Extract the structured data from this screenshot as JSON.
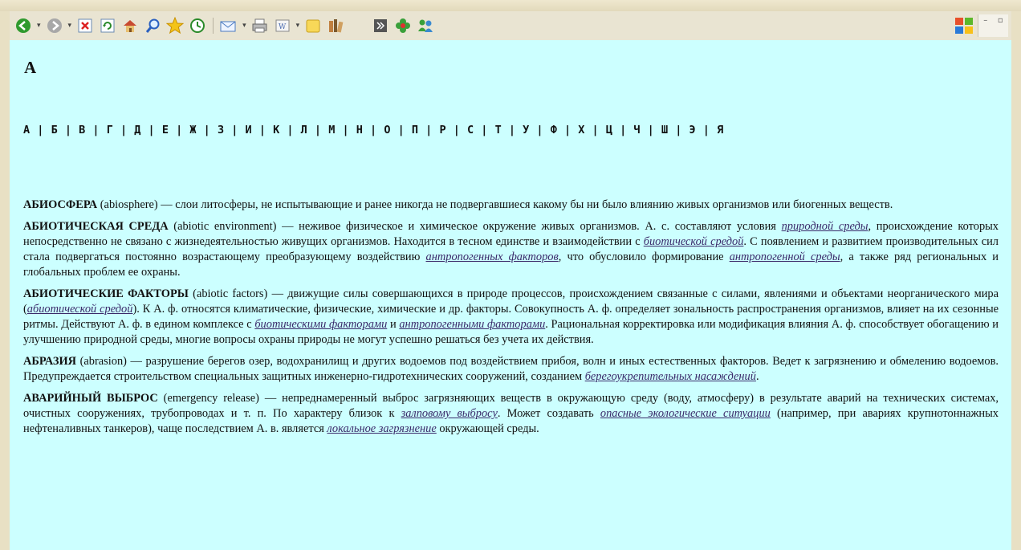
{
  "toolbar": {
    "buttons": [
      {
        "name": "back-button",
        "icon": "back-arrow-icon",
        "color": "#2a8a2a"
      },
      {
        "name": "forward-button",
        "icon": "forward-arrow-icon",
        "color": "#9a9a9a"
      },
      {
        "name": "stop-button",
        "icon": "stop-icon",
        "color": "#d22"
      },
      {
        "name": "refresh-button",
        "icon": "refresh-icon",
        "color": "#2a8a2a"
      },
      {
        "name": "home-button",
        "icon": "home-icon",
        "color": "#c8a040"
      },
      {
        "name": "search-button",
        "icon": "search-icon",
        "color": "#2a60c0"
      },
      {
        "name": "favorites-button",
        "icon": "star-icon",
        "color": "#f0c020"
      },
      {
        "name": "history-button",
        "icon": "history-icon",
        "color": "#2a8a2a"
      },
      {
        "name": "mail-button",
        "icon": "mail-icon",
        "color": "#4a7ac0"
      },
      {
        "name": "print-button",
        "icon": "print-icon",
        "color": "#777"
      },
      {
        "name": "edit-button",
        "icon": "word-icon",
        "color": "#4a6ab0"
      },
      {
        "name": "notes-button",
        "icon": "note-icon",
        "color": "#f5d060"
      },
      {
        "name": "research-button",
        "icon": "books-icon",
        "color": "#a07030"
      },
      {
        "name": "app-button-1",
        "icon": "app-icon",
        "color": "#333"
      },
      {
        "name": "app-button-2",
        "icon": "flower-icon",
        "color": "#3a9a3a"
      },
      {
        "name": "messenger-button",
        "icon": "messenger-icon",
        "color": "#3a8ad0"
      }
    ],
    "win_controls": {
      "minimize": "–",
      "maximize": "▫"
    }
  },
  "page": {
    "letter": "А",
    "alphabet": [
      "А",
      "Б",
      "В",
      "Г",
      "Д",
      "Е",
      "Ж",
      "З",
      "И",
      "К",
      "Л",
      "М",
      "Н",
      "О",
      "П",
      "Р",
      "С",
      "Т",
      "У",
      "Ф",
      "Х",
      "Ц",
      "Ч",
      "Ш",
      "Э",
      "Я"
    ],
    "separator": "|"
  },
  "entries": [
    {
      "parts": [
        {
          "t": "term",
          "v": "АБИОСФЕРА"
        },
        {
          "t": "text",
          "v": " (abiosphere) — слои литосферы, не испытывающие и ранее никогда не подвергавшиеся какому бы ни было влиянию живых организмов или биогенных веществ."
        }
      ]
    },
    {
      "parts": [
        {
          "t": "term",
          "v": "АБИОТИЧЕСКАЯ СРЕДА"
        },
        {
          "t": "text",
          "v": " (abiotic environment) — неживое физическое и химическое окружение живых организмов. А. с. составляют условия "
        },
        {
          "t": "link",
          "v": "природной среды"
        },
        {
          "t": "text",
          "v": ", происхождение которых непосредственно не связано с жизнедеятельностью живущих организмов. Находится в тесном единстве и взаимодействии с "
        },
        {
          "t": "link",
          "v": "биотической средой"
        },
        {
          "t": "text",
          "v": ". С появлением и развитием производительных сил стала подвергаться постоянно возрастающему преобразующему воздействию "
        },
        {
          "t": "link",
          "v": "антропогенных факторов"
        },
        {
          "t": "text",
          "v": ", что обусловило формирование "
        },
        {
          "t": "link",
          "v": "антропогенной среды"
        },
        {
          "t": "text",
          "v": ", а также ряд региональных и глобальных проблем ее охраны."
        }
      ]
    },
    {
      "parts": [
        {
          "t": "term",
          "v": "АБИОТИЧЕСКИЕ ФАКТОРЫ"
        },
        {
          "t": "text",
          "v": " (abiotic factors) — движущие силы совершающихся в природе процессов, происхождением связанные с силами, явлениями и объектами неорганического мира ("
        },
        {
          "t": "link",
          "v": "абиотической средой"
        },
        {
          "t": "text",
          "v": "). К А. ф. относятся климатические, физические, химические и др. факторы. Совокупность А. ф. определяет зональность распространения организмов, влияет на их сезонные ритмы. Действуют А. ф. в едином комплексе с "
        },
        {
          "t": "link",
          "v": "биотическими факторами"
        },
        {
          "t": "text",
          "v": " и "
        },
        {
          "t": "link",
          "v": "антропогенными факторами"
        },
        {
          "t": "text",
          "v": ". Рациональная корректировка или модификация влияния А. ф. способствует обогащению и улучшению природной среды, многие вопросы охраны природы не могут успешно решаться без учета их действия."
        }
      ]
    },
    {
      "parts": [
        {
          "t": "term",
          "v": "АБРАЗИЯ"
        },
        {
          "t": "text",
          "v": " (abrasion) — разрушение берегов озер, водохранилищ и других водоемов под воздействием прибоя, волн и иных естественных факторов. Ведет к загрязнению и обмелению водоемов. Предупреждается строительством специальных защитных инженерно-гидротехнических сооружений, созданием "
        },
        {
          "t": "link",
          "v": "берегоукрепительных насаждений"
        },
        {
          "t": "text",
          "v": "."
        }
      ]
    },
    {
      "parts": [
        {
          "t": "term",
          "v": "АВАРИЙНЫЙ ВЫБРОС"
        },
        {
          "t": "text",
          "v": " (emergency release) — непреднамеренный выброс загрязняющих веществ в окружающую среду (воду, атмосферу) в результате аварий на технических системах, очистных сооружениях, трубопроводах и т. п. По характеру близок к "
        },
        {
          "t": "link",
          "v": "залповому выбросу"
        },
        {
          "t": "text",
          "v": ". Может создавать "
        },
        {
          "t": "link",
          "v": "опасные экологические ситуации"
        },
        {
          "t": "text",
          "v": " (например, при авариях крупнотоннажных нефтеналивных танкеров), чаще последствием А. в. является "
        },
        {
          "t": "link",
          "v": "локальное загрязнение"
        },
        {
          "t": "text",
          "v": " окружающей среды."
        }
      ]
    }
  ]
}
